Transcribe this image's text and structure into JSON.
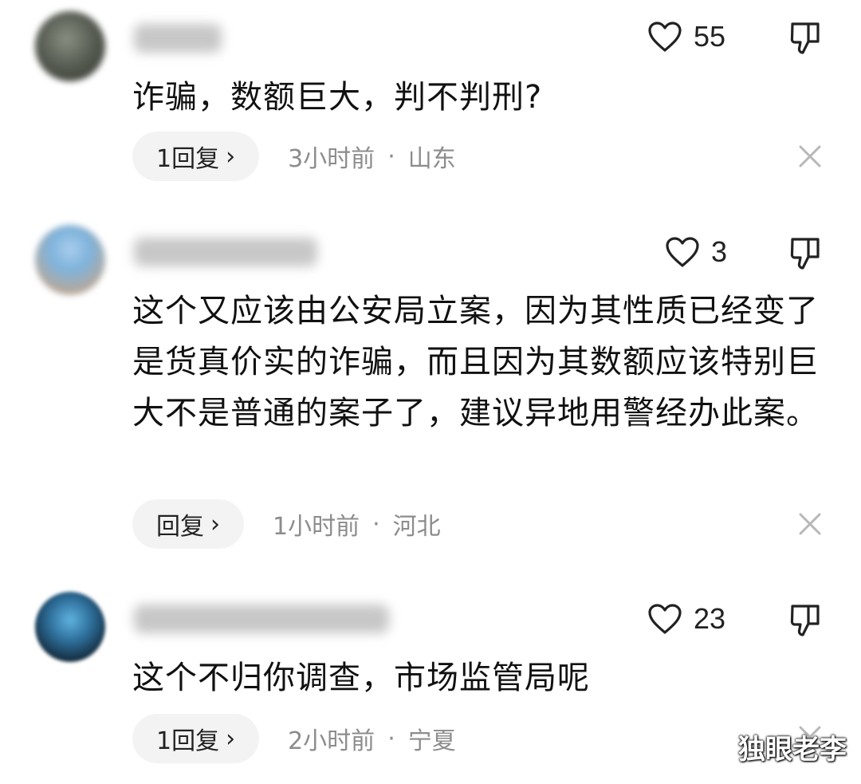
{
  "comments": [
    {
      "likes": "55",
      "text": "诈骗，数额巨大，判不判刑?",
      "reply_label": "1回复",
      "time": "3小时前",
      "location": "山东"
    },
    {
      "likes": "3",
      "text": "这个又应该由公安局立案，因为其性质已经变了是货真价实的诈骗，而且因为其数额应该特别巨大不是普通的案子了，建议异地用警经办此案。",
      "reply_label": "回复",
      "time": "1小时前",
      "location": "河北"
    },
    {
      "likes": "23",
      "text": "这个不归你调查，市场监管局呢",
      "reply_label": "1回复",
      "time": "2小时前",
      "location": "宁夏"
    }
  ],
  "separator": "·",
  "chevron": "›",
  "watermark": "独眼老李",
  "icons": {
    "like": "heart-outline-icon",
    "dislike": "thumbs-down-outline-icon",
    "close": "close-x-icon"
  }
}
